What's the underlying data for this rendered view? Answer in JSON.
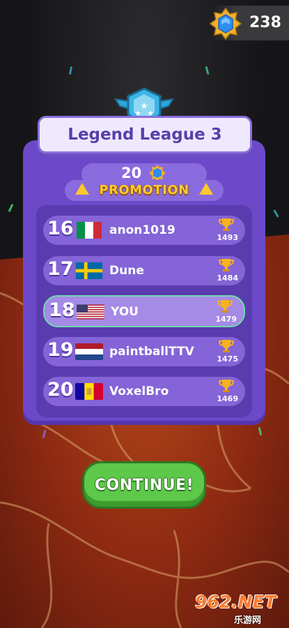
{
  "currency": {
    "gems": "238",
    "icon": "blue-gem-icon"
  },
  "league": {
    "title": "Legend League 3",
    "emblem_icon": "winged-shield-stars-icon"
  },
  "promotion": {
    "gem_reward": "20",
    "label": "PROMOTION"
  },
  "leaderboard": [
    {
      "rank": "16",
      "name": "anon1019",
      "score": "1493",
      "flag": "italy",
      "is_player": false
    },
    {
      "rank": "17",
      "name": "Dune",
      "score": "1484",
      "flag": "sweden",
      "is_player": false
    },
    {
      "rank": "18",
      "name": "YOU",
      "score": "1479",
      "flag": "usa",
      "is_player": true
    },
    {
      "rank": "19",
      "name": "paintballTTV",
      "score": "1475",
      "flag": "netherlands",
      "is_player": false
    },
    {
      "rank": "20",
      "name": "VoxelBro",
      "score": "1469",
      "flag": "andorra",
      "is_player": false
    }
  ],
  "continue_label": "CONTINUE!",
  "watermark": {
    "brand": "962.NET",
    "subtitle": "乐游网"
  },
  "colors": {
    "panel": "#6b49c8",
    "row": "#8464d6",
    "highlight_border": "#6fd9b0",
    "promotion_text": "#ffc93a",
    "continue": "#5ec84a"
  }
}
